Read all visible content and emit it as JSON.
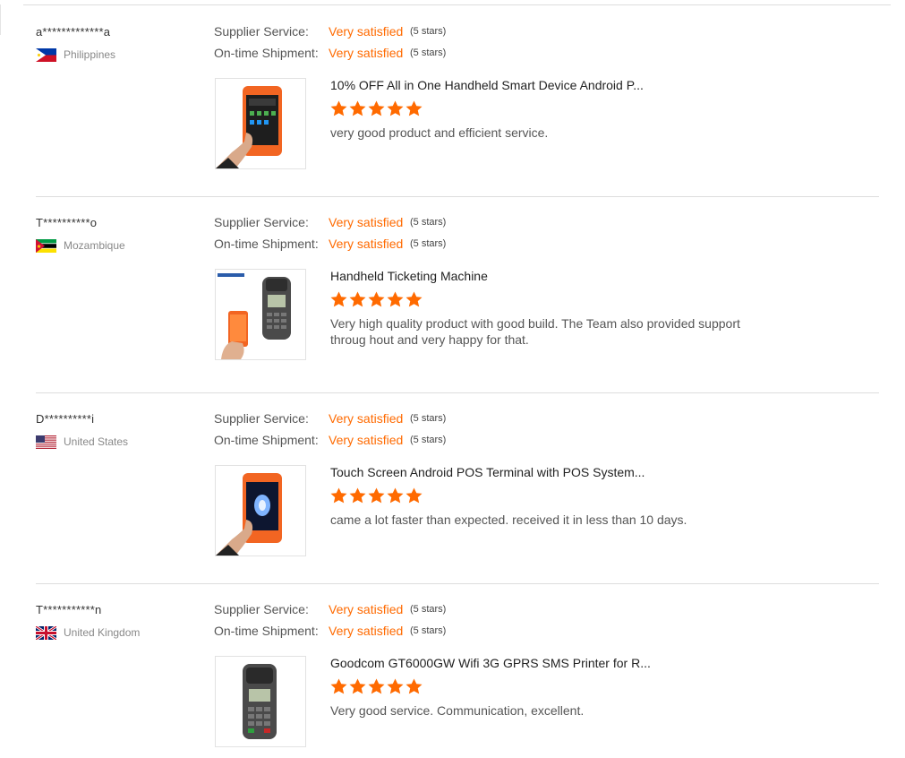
{
  "reviews": [
    {
      "user": "a*************a",
      "country": "Philippines",
      "flag": "philippines-flag-icon",
      "supplier_service_label": "Supplier Service:",
      "supplier_service_value": "Very satisfied",
      "supplier_service_stars": "(5 stars)",
      "shipment_label": "On-time Shipment:",
      "shipment_value": "Very satisfied",
      "shipment_stars": "(5 stars)",
      "product_title": "10% OFF All in One Handheld Smart Device Android P...",
      "rating": 5,
      "comment": "very good product and efficient service."
    },
    {
      "user": "T**********o",
      "country": "Mozambique",
      "flag": "mozambique-flag-icon",
      "supplier_service_label": "Supplier Service:",
      "supplier_service_value": "Very satisfied",
      "supplier_service_stars": "(5 stars)",
      "shipment_label": "On-time Shipment:",
      "shipment_value": "Very satisfied",
      "shipment_stars": "(5 stars)",
      "product_title": "Handheld Ticketing Machine",
      "rating": 5,
      "comment": "Very high quality product with good build. The Team also provided support throug hout and very happy for that."
    },
    {
      "user": "D**********i",
      "country": "United States",
      "flag": "united-states-flag-icon",
      "supplier_service_label": "Supplier Service:",
      "supplier_service_value": "Very satisfied",
      "supplier_service_stars": "(5 stars)",
      "shipment_label": "On-time Shipment:",
      "shipment_value": "Very satisfied",
      "shipment_stars": "(5 stars)",
      "product_title": "Touch Screen Android POS Terminal with POS System...",
      "rating": 5,
      "comment": "came a lot faster than expected. received it in less than 10 days."
    },
    {
      "user": "T***********n",
      "country": "United Kingdom",
      "flag": "united-kingdom-flag-icon",
      "supplier_service_label": "Supplier Service:",
      "supplier_service_value": "Very satisfied",
      "supplier_service_stars": "(5 stars)",
      "shipment_label": "On-time Shipment:",
      "shipment_value": "Very satisfied",
      "shipment_stars": "(5 stars)",
      "product_title": "Goodcom GT6000GW Wifi 3G GPRS SMS Printer for R...",
      "rating": 5,
      "comment": "Very good service. Communication, excellent."
    }
  ],
  "colors": {
    "accent": "#ff6a00",
    "divider": "#dddddd",
    "muted_text": "#888888"
  }
}
